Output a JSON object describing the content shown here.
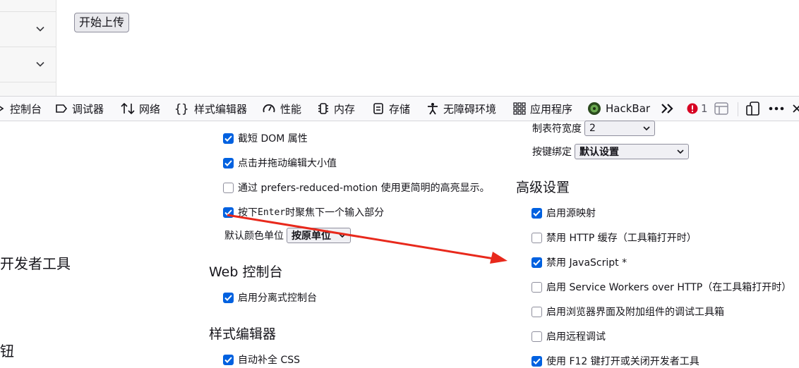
{
  "page": {
    "upload_button": "开始上传"
  },
  "toolbar": {
    "tabs": [
      {
        "label": "控制台",
        "icon": "console-icon"
      },
      {
        "label": "调试器",
        "icon": "debugger-icon"
      },
      {
        "label": "网络",
        "icon": "network-icon"
      },
      {
        "label": "样式编辑器",
        "icon": "style-editor-icon"
      },
      {
        "label": "性能",
        "icon": "performance-icon"
      },
      {
        "label": "内存",
        "icon": "memory-icon"
      },
      {
        "label": "存储",
        "icon": "storage-icon"
      },
      {
        "label": "无障碍环境",
        "icon": "accessibility-icon"
      },
      {
        "label": "应用程序",
        "icon": "application-icon"
      },
      {
        "label": "HackBar",
        "icon": "hackbar-icon"
      }
    ],
    "error_count": "1"
  },
  "settings": {
    "left_fragments": [
      "开发者工具",
      "钮"
    ],
    "inspector_options": [
      {
        "label": "截短 DOM 属性",
        "checked": true
      },
      {
        "label": "点击并拖动编辑大小值",
        "checked": true
      },
      {
        "label": "通过 prefers-reduced-motion 使用更简明的高亮显示。",
        "checked": false
      },
      {
        "pre": "按下 ",
        "code": "Enter",
        "post": " 时聚焦下一个输入部分",
        "checked": true
      }
    ],
    "default_color_unit": {
      "label": "默认颜色单位",
      "value": "按原单位"
    },
    "web_console": {
      "heading": "Web 控制台",
      "options": [
        {
          "label": "启用分离式控制台",
          "checked": true
        }
      ]
    },
    "style_editor": {
      "heading": "样式编辑器",
      "options": [
        {
          "label": "自动补全 CSS",
          "checked": true
        }
      ]
    },
    "tab_size": {
      "label": "制表符宽度",
      "value": "2"
    },
    "keybinding": {
      "label": "按键绑定",
      "value": "默认设置"
    },
    "advanced": {
      "heading": "高级设置",
      "options": [
        {
          "label": "启用源映射",
          "checked": true
        },
        {
          "label": "禁用 HTTP 缓存（工具箱打开时）",
          "checked": false
        },
        {
          "label": "禁用 JavaScript *",
          "checked": true
        },
        {
          "label": "启用 Service Workers over HTTP（在工具箱打开时）",
          "checked": false
        },
        {
          "label": "启用浏览器界面及附加组件的调试工具箱",
          "checked": false
        },
        {
          "label": "启用远程调试",
          "checked": false
        },
        {
          "label": "使用 F12 键打开或关闭开发者工具",
          "checked": true
        }
      ]
    }
  },
  "colors": {
    "accent": "#0061e0",
    "annotation_arrow": "#e8291c",
    "error": "#d70022"
  }
}
